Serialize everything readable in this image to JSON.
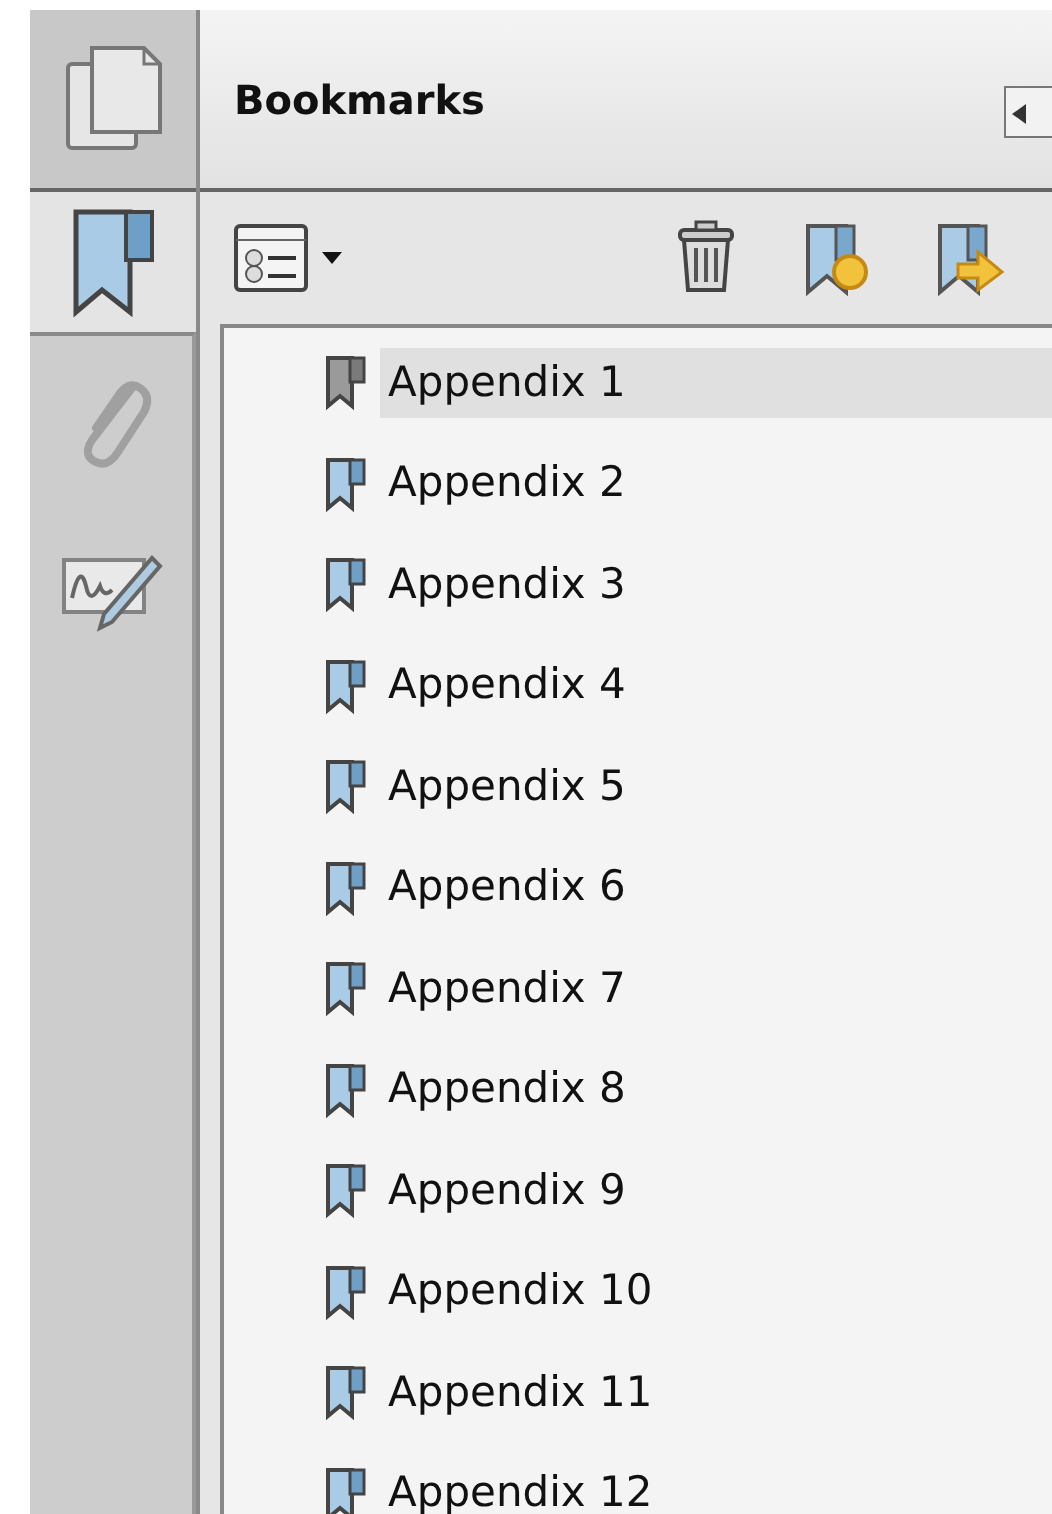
{
  "rail": {
    "tabs": [
      {
        "kind": "pages",
        "selected": false
      },
      {
        "kind": "bookmarks",
        "selected": true
      },
      {
        "kind": "attachments",
        "selected": false
      },
      {
        "kind": "signatures",
        "selected": false
      }
    ]
  },
  "panel": {
    "title": "Bookmarks"
  },
  "bookmarks": [
    {
      "label": "Appendix 1",
      "selected": true
    },
    {
      "label": "Appendix 2",
      "selected": false
    },
    {
      "label": "Appendix 3",
      "selected": false
    },
    {
      "label": "Appendix 4",
      "selected": false
    },
    {
      "label": "Appendix 5",
      "selected": false
    },
    {
      "label": "Appendix 6",
      "selected": false
    },
    {
      "label": "Appendix 7",
      "selected": false
    },
    {
      "label": "Appendix 8",
      "selected": false
    },
    {
      "label": "Appendix 9",
      "selected": false
    },
    {
      "label": "Appendix 10",
      "selected": false
    },
    {
      "label": "Appendix 11",
      "selected": false
    },
    {
      "label": "Appendix 12",
      "selected": false
    }
  ]
}
